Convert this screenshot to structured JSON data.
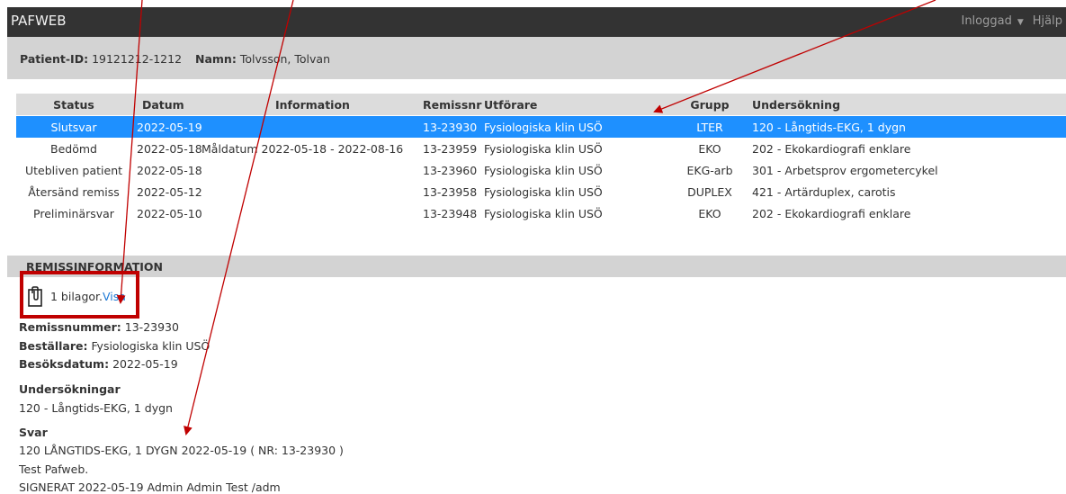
{
  "navbar": {
    "brand": "PAFWEB",
    "login_label": "Inloggad",
    "help_label": "Hjälp"
  },
  "patient": {
    "id_label": "Patient-ID:",
    "id_value": "19121212-1212",
    "name_label": "Namn:",
    "name_value": "Tolvsson, Tolvan"
  },
  "table": {
    "headers": [
      "Status",
      "Datum",
      "Information",
      "Remissnr",
      "Utförare",
      "Grupp",
      "Undersökning"
    ],
    "rows": [
      {
        "status": "Slutsvar",
        "datum": "2022-05-19",
        "info": "",
        "remissnr": "13-23930",
        "utforare": "Fysiologiska klin USÖ",
        "grupp": "LTER",
        "undersokning": "120 - Långtids-EKG, 1 dygn",
        "selected": true
      },
      {
        "status": "Bedömd",
        "datum": "2022-05-18",
        "info": "Måldatum 2022-05-18 - 2022-08-16",
        "remissnr": "13-23959",
        "utforare": "Fysiologiska klin USÖ",
        "grupp": "EKO",
        "undersokning": "202 - Ekokardiografi enklare",
        "selected": false
      },
      {
        "status": "Utebliven patient",
        "datum": "2022-05-18",
        "info": "",
        "remissnr": "13-23960",
        "utforare": "Fysiologiska klin USÖ",
        "grupp": "EKG-arb",
        "undersokning": "301 - Arbetsprov ergometercykel",
        "selected": false
      },
      {
        "status": "Återsänd remiss",
        "datum": "2022-05-12",
        "info": "",
        "remissnr": "13-23958",
        "utforare": "Fysiologiska klin USÖ",
        "grupp": "DUPLEX",
        "undersokning": "421 - Artärduplex, carotis",
        "selected": false
      },
      {
        "status": "Preliminärsvar",
        "datum": "2022-05-10",
        "info": "",
        "remissnr": "13-23948",
        "utforare": "Fysiologiska klin USÖ",
        "grupp": "EKO",
        "undersokning": "202 - Ekokardiografi enklare",
        "selected": false
      }
    ]
  },
  "remiss": {
    "section_title": "REMISSINFORMATION",
    "attachments_text": "1 bilagor.",
    "attachments_link": "Visa",
    "remissnummer_label": "Remissnummer:",
    "remissnummer_value": "13-23930",
    "bestallare_label": "Beställare:",
    "bestallare_value": "Fysiologiska klin USÖ",
    "besoksdatum_label": "Besöksdatum:",
    "besoksdatum_value": "2022-05-19",
    "undersokningar_title": "Undersökningar",
    "undersokningar_value": "120 - Långtids-EKG, 1 dygn",
    "svar_title": "Svar",
    "svar_line1": "120 LÅNGTIDS-EKG, 1 DYGN 2022-05-19 ( NR: 13-23930 )",
    "svar_line2": "Test Pafweb.",
    "svar_line3": "SIGNERAT 2022-05-19 Admin Admin Test /adm"
  },
  "colors": {
    "navbar": "#333333",
    "selected_row": "#1e90ff",
    "link": "#1e7ad6",
    "annotation": "#c00000"
  }
}
